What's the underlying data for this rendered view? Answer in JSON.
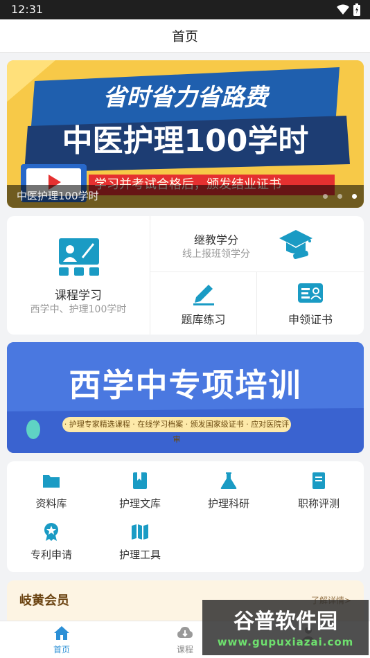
{
  "status": {
    "time": "12:31"
  },
  "navbar": {
    "title": "首页"
  },
  "banner": {
    "headline_1": "省时省力省路费",
    "headline_2": "中医护理100学时",
    "sub": "学习并考试合格后，颁发结业证书",
    "caption": "中医护理100学时",
    "dots": 3,
    "active_dot": 3
  },
  "grid": {
    "course": {
      "title": "课程学习",
      "subtitle": "西学中、护理100学时"
    },
    "credit": {
      "title": "继教学分",
      "subtitle": "线上报班领学分"
    },
    "practice": {
      "title": "题库练习"
    },
    "certificate": {
      "title": "申领证书"
    }
  },
  "promo": {
    "title": "西学中专项培训",
    "strip": "· 护理专家精选课程 · 在线学习档案 · 颁发国家级证书 · 应对医院评审"
  },
  "tools": [
    {
      "label": "资料库",
      "icon": "folder-icon"
    },
    {
      "label": "护理文库",
      "icon": "bookmark-book-icon"
    },
    {
      "label": "护理科研",
      "icon": "flask-icon"
    },
    {
      "label": "职称评测",
      "icon": "book-icon"
    },
    {
      "label": "专利申请",
      "icon": "badge-icon"
    },
    {
      "label": "护理工具",
      "icon": "map-icon"
    }
  ],
  "vip": {
    "name": "岐黄会员",
    "more": "了解详情>"
  },
  "tabbar": [
    {
      "label": "首页",
      "icon": "home-icon",
      "active": true
    },
    {
      "label": "课程",
      "icon": "cloud-icon",
      "active": false
    },
    {
      "label": "",
      "icon": "user-icon",
      "active": false
    }
  ],
  "watermark": {
    "line1": "谷普软件园",
    "line2": "www.gupuxiazai.com"
  },
  "colors": {
    "accent": "#2b8fd6",
    "icon_teal": "#1a9bc4",
    "vip_text": "#6a4210"
  }
}
